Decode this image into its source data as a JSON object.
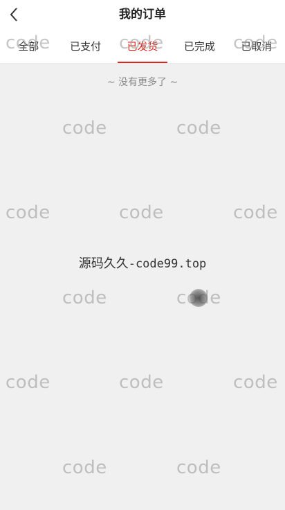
{
  "header": {
    "title": "我的订单",
    "back_icon": "chevron-left-icon"
  },
  "tabs": [
    {
      "label": "全部",
      "active": false
    },
    {
      "label": "已支付",
      "active": false
    },
    {
      "label": "已发货",
      "active": true
    },
    {
      "label": "已完成",
      "active": false
    },
    {
      "label": "已取消",
      "active": false
    }
  ],
  "list": {
    "end_text": "~ 没有更多了 ~"
  },
  "overlay": {
    "text_cn": "源码久久",
    "text_en": "-code99.top"
  },
  "watermark": {
    "text": "code"
  },
  "colors": {
    "accent": "#e2231a",
    "background": "#f0f0f0"
  }
}
